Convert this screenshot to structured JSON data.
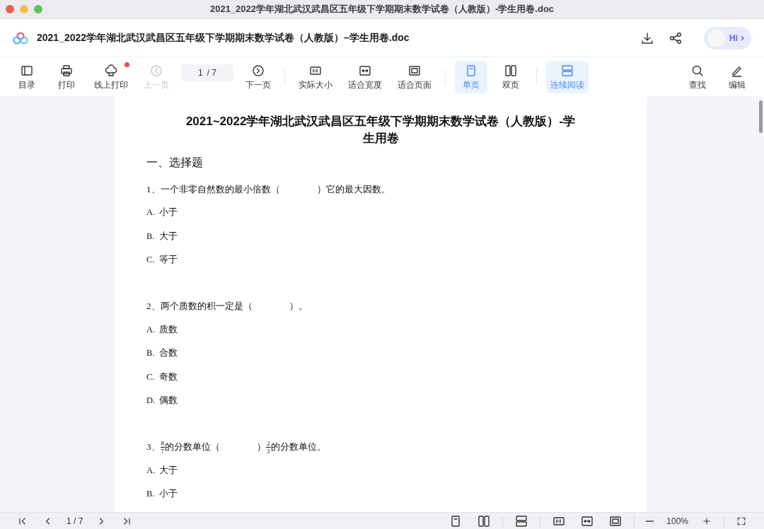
{
  "window": {
    "title": "2021_2022学年湖北武汉武昌区五年级下学期期末数学试卷（人教版）-学生用卷.doc"
  },
  "header": {
    "file_name": "2021_2022学年湖北武汉武昌区五年级下学期期末数学试卷（人教版）–学生用卷.doc",
    "assistant_label": "Hi"
  },
  "toolbar": [
    {
      "kind": "button",
      "label": "目录",
      "disabled": false,
      "selected": false,
      "badge": false
    },
    {
      "kind": "button",
      "label": "打印",
      "disabled": false,
      "selected": false,
      "badge": false
    },
    {
      "kind": "button",
      "label": "线上打印",
      "disabled": false,
      "selected": false,
      "badge": true
    },
    {
      "kind": "button",
      "label": "上一页",
      "disabled": true,
      "selected": false,
      "badge": false
    },
    {
      "kind": "pager",
      "current": "1",
      "total": "/ 7"
    },
    {
      "kind": "button",
      "label": "下一页",
      "disabled": false,
      "selected": false,
      "badge": false
    },
    {
      "kind": "divider"
    },
    {
      "kind": "button",
      "label": "实际大小",
      "disabled": false,
      "selected": false,
      "badge": false
    },
    {
      "kind": "button",
      "label": "适合宽度",
      "disabled": false,
      "selected": false,
      "badge": false
    },
    {
      "kind": "button",
      "label": "适合页面",
      "disabled": false,
      "selected": false,
      "badge": false
    },
    {
      "kind": "divider"
    },
    {
      "kind": "button",
      "label": "单页",
      "disabled": false,
      "selected": true,
      "badge": false
    },
    {
      "kind": "button",
      "label": "双页",
      "disabled": false,
      "selected": false,
      "badge": false
    },
    {
      "kind": "divider"
    },
    {
      "kind": "button",
      "label": "连续阅读",
      "disabled": false,
      "selected": true,
      "badge": false
    },
    {
      "kind": "spacer"
    },
    {
      "kind": "button",
      "label": "查找",
      "disabled": false,
      "selected": false,
      "badge": false
    },
    {
      "kind": "button",
      "label": "编辑",
      "disabled": false,
      "selected": false,
      "badge": false
    }
  ],
  "document": {
    "title": "2021~2022学年湖北武汉武昌区五年级下学期期末数学试卷（人教版）-学生用卷",
    "section": "一、选择题",
    "questions": [
      {
        "segments": [
          {
            "kind": "text",
            "text": "1、一个非零自然数的最小倍数（　　　　）它的最大因数。"
          }
        ],
        "options": [
          "A.  小于",
          "B.  大于",
          "C.  等于"
        ]
      },
      {
        "segments": [
          {
            "kind": "text",
            "text": "2、两个质数的积一定是（　　　　）。"
          }
        ],
        "options": [
          "A.  质数",
          "B.  合数",
          "C.  奇数",
          "D.  偶数"
        ]
      },
      {
        "segments": [
          {
            "kind": "text",
            "text": "3、"
          },
          {
            "kind": "fraction",
            "numerator": "8",
            "denominator": "7"
          },
          {
            "kind": "text",
            "text": "的分数单位（　　　　）"
          },
          {
            "kind": "fraction",
            "numerator": "2",
            "denominator": "3"
          },
          {
            "kind": "text",
            "text": "的分数单位。"
          }
        ],
        "options": [
          "A.  大于",
          "B.  小于"
        ]
      }
    ]
  },
  "status_bar": {
    "page": "1 / 7",
    "zoom": "100%"
  }
}
